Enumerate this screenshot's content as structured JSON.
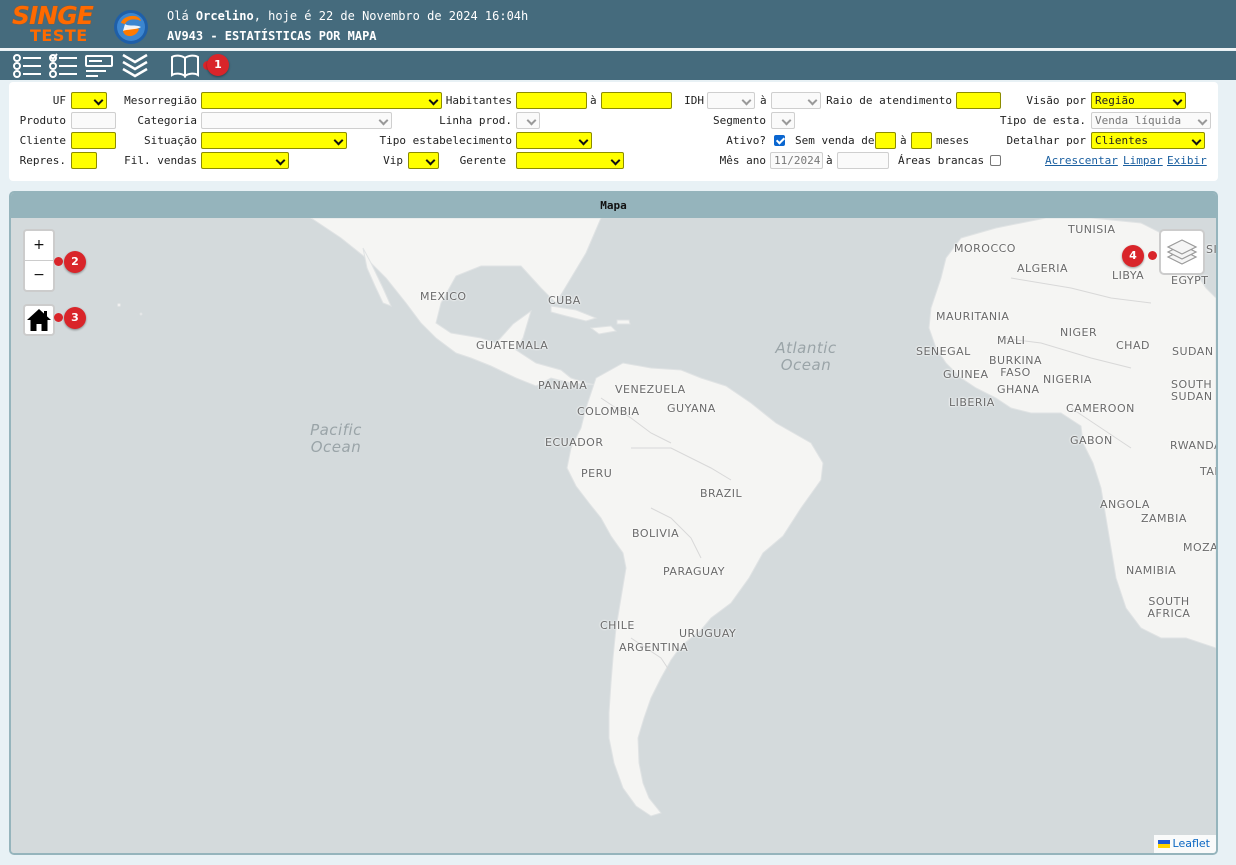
{
  "header": {
    "logo_top": "SINGE",
    "logo_bottom": "TESTE",
    "greeting_prefix": "Olá ",
    "user_name": "Orcelino",
    "greeting_suffix": ", hoje é 22 de Novembro de 2024 16:04h",
    "page_title": "AV943 - ESTATÍSTICAS POR MAPA"
  },
  "toolbar": {
    "icons": [
      "list-icon",
      "checklist-icon",
      "form-icon",
      "chevrons-down-icon",
      "book-icon"
    ],
    "badge_1": "1"
  },
  "filters": {
    "uf_label": "UF",
    "mesorregiao_label": "Mesorregião",
    "habitantes_label": "Habitantes",
    "a_label": "à",
    "idh_label": "IDH",
    "raio_label": "Raio de atendimento",
    "visao_label": "Visão por",
    "visao_value": "Região",
    "produto_label": "Produto",
    "categoria_label": "Categoria",
    "linha_label": "Linha prod.",
    "segmento_label": "Segmento",
    "tipo_esta_label": "Tipo de esta.",
    "tipo_esta_value": "Venda líquida",
    "cliente_label": "Cliente",
    "situacao_label": "Situação",
    "tipo_estab_label": "Tipo estabelecimento",
    "ativo_label": "Ativo?",
    "ativo_checked": true,
    "sem_venda_label": "Sem venda de",
    "meses_label": "meses",
    "detalhar_label": "Detalhar por",
    "detalhar_value": "Clientes",
    "repres_label": "Repres.",
    "fil_label": "Fil. vendas",
    "vip_label": "Vip",
    "gerente_label": "Gerente",
    "mes_ano_label": "Mês ano",
    "mes_ano_value": "11/2024",
    "areas_label": "Áreas brancas",
    "areas_checked": false,
    "acrescentar_link": "Acrescentar",
    "limpar_link": "Limpar",
    "exibir_link": "Exibir"
  },
  "map": {
    "title": "Mapa",
    "zoom_in": "+",
    "zoom_out": "−",
    "badges": [
      "2",
      "3",
      "4"
    ],
    "attribution": "Leaflet",
    "oceans": [
      {
        "name": "Atlantic\nOcean"
      },
      {
        "name": "Pacific\nOcean"
      }
    ],
    "places": [
      "TUNISIA",
      "MOROCCO",
      "ALGERIA",
      "LIBYA",
      "EGYPT",
      "MEXICO",
      "CUBA",
      "MAURITANIA",
      "MALI",
      "NIGER",
      "CHAD",
      "SUDAN",
      "SENEGAL",
      "BURKINA FASO",
      "GUINEA",
      "GHANA",
      "NIGERIA",
      "SOUTH SUDAN",
      "GUATEMALA",
      "PANAMA",
      "VENEZUELA",
      "GUYANA",
      "COLOMBIA",
      "LIBERIA",
      "CAMEROON",
      "ECUADOR",
      "GABON",
      "RWANDA",
      "PERU",
      "BRAZIL",
      "TAN",
      "ANGOLA",
      "ZAMBIA",
      "BOLIVIA",
      "MOZA",
      "PARAGUAY",
      "NAMIBIA",
      "CHILE",
      "URUGUAY",
      "SOUTH AFRICA",
      "ARGENTINA",
      "SI"
    ],
    "colors": {
      "land": "#f5f5f3",
      "sea": "#d4dadc",
      "badge": "#d9252a"
    }
  }
}
